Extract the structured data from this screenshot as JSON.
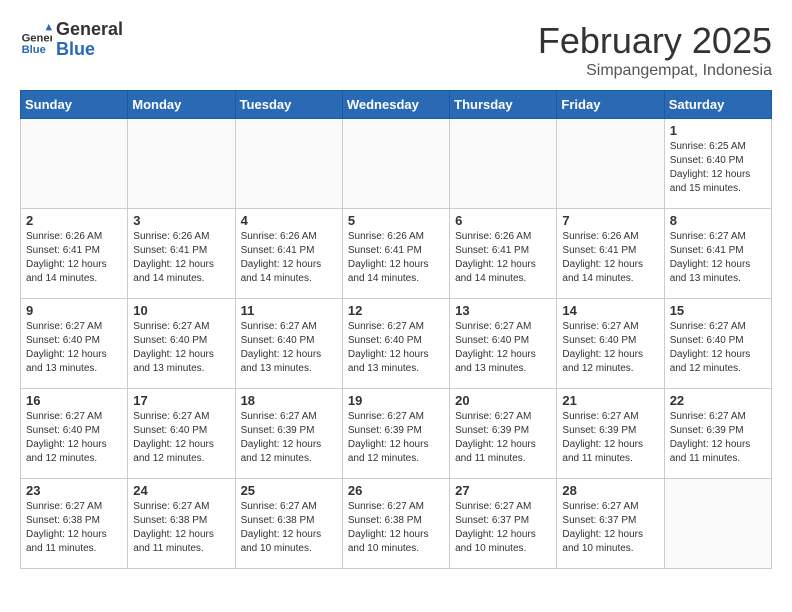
{
  "logo": {
    "line1": "General",
    "line2": "Blue"
  },
  "title": "February 2025",
  "subtitle": "Simpangempat, Indonesia",
  "weekdays": [
    "Sunday",
    "Monday",
    "Tuesday",
    "Wednesday",
    "Thursday",
    "Friday",
    "Saturday"
  ],
  "weeks": [
    [
      {
        "day": "",
        "info": ""
      },
      {
        "day": "",
        "info": ""
      },
      {
        "day": "",
        "info": ""
      },
      {
        "day": "",
        "info": ""
      },
      {
        "day": "",
        "info": ""
      },
      {
        "day": "",
        "info": ""
      },
      {
        "day": "1",
        "info": "Sunrise: 6:25 AM\nSunset: 6:40 PM\nDaylight: 12 hours\nand 15 minutes."
      }
    ],
    [
      {
        "day": "2",
        "info": "Sunrise: 6:26 AM\nSunset: 6:41 PM\nDaylight: 12 hours\nand 14 minutes."
      },
      {
        "day": "3",
        "info": "Sunrise: 6:26 AM\nSunset: 6:41 PM\nDaylight: 12 hours\nand 14 minutes."
      },
      {
        "day": "4",
        "info": "Sunrise: 6:26 AM\nSunset: 6:41 PM\nDaylight: 12 hours\nand 14 minutes."
      },
      {
        "day": "5",
        "info": "Sunrise: 6:26 AM\nSunset: 6:41 PM\nDaylight: 12 hours\nand 14 minutes."
      },
      {
        "day": "6",
        "info": "Sunrise: 6:26 AM\nSunset: 6:41 PM\nDaylight: 12 hours\nand 14 minutes."
      },
      {
        "day": "7",
        "info": "Sunrise: 6:26 AM\nSunset: 6:41 PM\nDaylight: 12 hours\nand 14 minutes."
      },
      {
        "day": "8",
        "info": "Sunrise: 6:27 AM\nSunset: 6:41 PM\nDaylight: 12 hours\nand 13 minutes."
      }
    ],
    [
      {
        "day": "9",
        "info": "Sunrise: 6:27 AM\nSunset: 6:40 PM\nDaylight: 12 hours\nand 13 minutes."
      },
      {
        "day": "10",
        "info": "Sunrise: 6:27 AM\nSunset: 6:40 PM\nDaylight: 12 hours\nand 13 minutes."
      },
      {
        "day": "11",
        "info": "Sunrise: 6:27 AM\nSunset: 6:40 PM\nDaylight: 12 hours\nand 13 minutes."
      },
      {
        "day": "12",
        "info": "Sunrise: 6:27 AM\nSunset: 6:40 PM\nDaylight: 12 hours\nand 13 minutes."
      },
      {
        "day": "13",
        "info": "Sunrise: 6:27 AM\nSunset: 6:40 PM\nDaylight: 12 hours\nand 13 minutes."
      },
      {
        "day": "14",
        "info": "Sunrise: 6:27 AM\nSunset: 6:40 PM\nDaylight: 12 hours\nand 12 minutes."
      },
      {
        "day": "15",
        "info": "Sunrise: 6:27 AM\nSunset: 6:40 PM\nDaylight: 12 hours\nand 12 minutes."
      }
    ],
    [
      {
        "day": "16",
        "info": "Sunrise: 6:27 AM\nSunset: 6:40 PM\nDaylight: 12 hours\nand 12 minutes."
      },
      {
        "day": "17",
        "info": "Sunrise: 6:27 AM\nSunset: 6:40 PM\nDaylight: 12 hours\nand 12 minutes."
      },
      {
        "day": "18",
        "info": "Sunrise: 6:27 AM\nSunset: 6:39 PM\nDaylight: 12 hours\nand 12 minutes."
      },
      {
        "day": "19",
        "info": "Sunrise: 6:27 AM\nSunset: 6:39 PM\nDaylight: 12 hours\nand 12 minutes."
      },
      {
        "day": "20",
        "info": "Sunrise: 6:27 AM\nSunset: 6:39 PM\nDaylight: 12 hours\nand 11 minutes."
      },
      {
        "day": "21",
        "info": "Sunrise: 6:27 AM\nSunset: 6:39 PM\nDaylight: 12 hours\nand 11 minutes."
      },
      {
        "day": "22",
        "info": "Sunrise: 6:27 AM\nSunset: 6:39 PM\nDaylight: 12 hours\nand 11 minutes."
      }
    ],
    [
      {
        "day": "23",
        "info": "Sunrise: 6:27 AM\nSunset: 6:38 PM\nDaylight: 12 hours\nand 11 minutes."
      },
      {
        "day": "24",
        "info": "Sunrise: 6:27 AM\nSunset: 6:38 PM\nDaylight: 12 hours\nand 11 minutes."
      },
      {
        "day": "25",
        "info": "Sunrise: 6:27 AM\nSunset: 6:38 PM\nDaylight: 12 hours\nand 10 minutes."
      },
      {
        "day": "26",
        "info": "Sunrise: 6:27 AM\nSunset: 6:38 PM\nDaylight: 12 hours\nand 10 minutes."
      },
      {
        "day": "27",
        "info": "Sunrise: 6:27 AM\nSunset: 6:37 PM\nDaylight: 12 hours\nand 10 minutes."
      },
      {
        "day": "28",
        "info": "Sunrise: 6:27 AM\nSunset: 6:37 PM\nDaylight: 12 hours\nand 10 minutes."
      },
      {
        "day": "",
        "info": ""
      }
    ]
  ]
}
